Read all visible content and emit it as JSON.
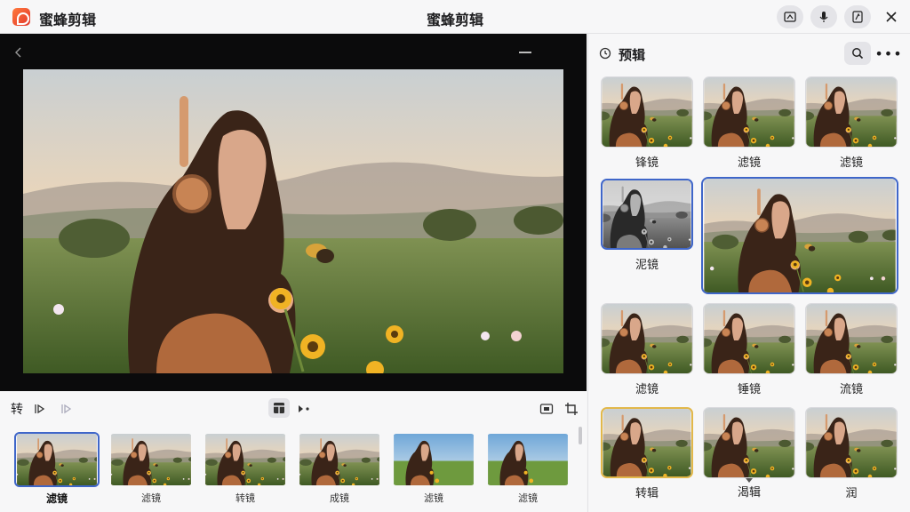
{
  "titlebar": {
    "app_name": "蜜蜂剪辑",
    "window_title": "蜜蜂剪辑",
    "buttons": [
      "screen-capture-icon",
      "microphone-icon",
      "pen-icon"
    ],
    "close_icon": "close-icon"
  },
  "toolbar": {
    "rotate_label": "转",
    "icons": [
      "flip-icon",
      "forward-icon",
      "layout-icon",
      "play-next-icon",
      "screenshot-icon",
      "crop-icon"
    ]
  },
  "filmstrip": {
    "items": [
      {
        "label": "滤镜",
        "active": true
      },
      {
        "label": "滤镜",
        "active": false
      },
      {
        "label": "转镜",
        "active": false
      },
      {
        "label": "成镜",
        "active": false
      },
      {
        "label": "滤镜",
        "active": false
      },
      {
        "label": "滤镜",
        "active": false
      }
    ]
  },
  "side": {
    "title": "预辑",
    "grid": [
      {
        "label": "锋镜"
      },
      {
        "label": "滤镜"
      },
      {
        "label": "滤镜"
      },
      {
        "label": "泥镜"
      },
      {
        "label": "滤镜"
      },
      {
        "label": "锤镜"
      },
      {
        "label": "流镜"
      },
      {
        "label": "转辑"
      },
      {
        "label": "渴辑"
      },
      {
        "label": "润"
      }
    ]
  },
  "colors": {
    "accent": "#3f66c9",
    "gold": "#e2b84a",
    "brand": "#e2362a"
  }
}
